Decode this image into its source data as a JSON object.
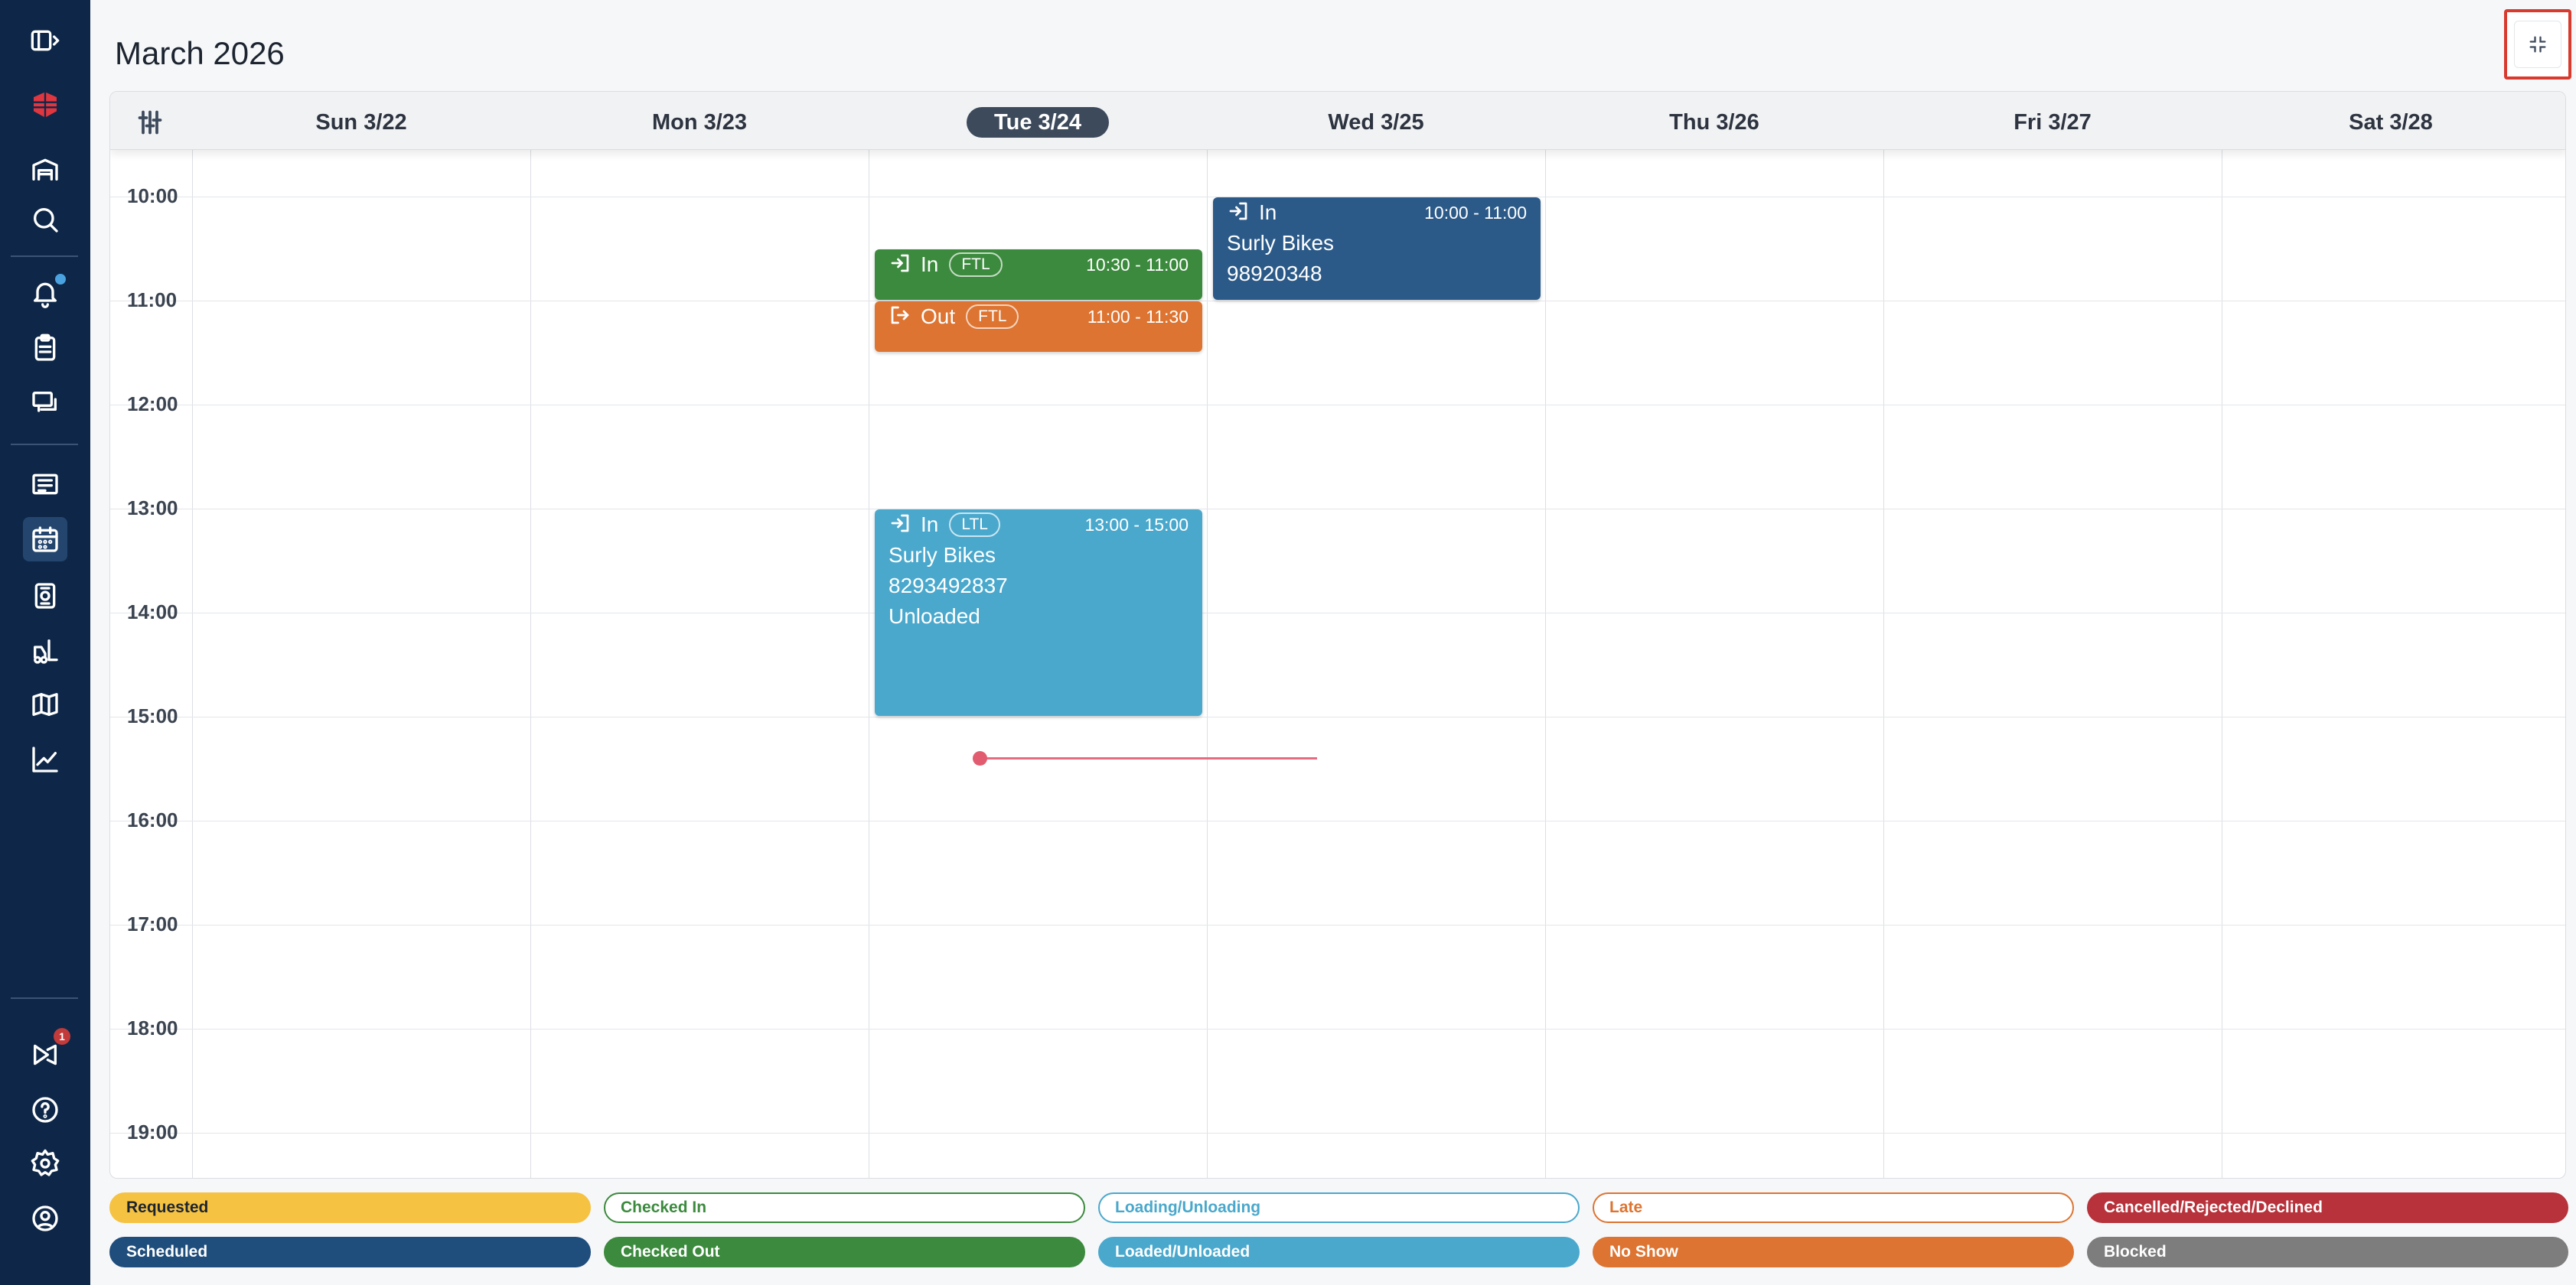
{
  "title": "March 2026",
  "sidebar": {
    "icons": [
      "sidebar-toggle-icon",
      "logo-icon",
      "warehouse-icon",
      "search-icon",
      "notifications-icon",
      "clipboard-icon",
      "chat-icon",
      "list-icon",
      "calendar-icon",
      "dock-icon",
      "forklift-icon",
      "map-icon",
      "analytics-icon",
      "announcements-icon",
      "help-icon",
      "settings-icon",
      "profile-icon"
    ],
    "announcement_badge": "1"
  },
  "header": {
    "collapse_icon": "collapse-icon",
    "filter_icon": "filter-sliders-icon"
  },
  "days": [
    {
      "label": "Sun 3/22",
      "today": false
    },
    {
      "label": "Mon 3/23",
      "today": false
    },
    {
      "label": "Tue 3/24",
      "today": true
    },
    {
      "label": "Wed 3/25",
      "today": false
    },
    {
      "label": "Thu 3/26",
      "today": false
    },
    {
      "label": "Fri 3/27",
      "today": false
    },
    {
      "label": "Sat 3/28",
      "today": false
    }
  ],
  "hours": [
    "10:00",
    "11:00",
    "12:00",
    "13:00",
    "14:00",
    "15:00",
    "16:00",
    "17:00",
    "18:00",
    "19:00"
  ],
  "events": [
    {
      "day": "Wed 3/25",
      "direction": "In",
      "type": "",
      "time": "10:00 - 11:00",
      "lines": [
        "Surly Bikes",
        "98920348"
      ],
      "color": "#2c5a88",
      "status": "Scheduled"
    },
    {
      "day": "Tue 3/24",
      "direction": "In",
      "type": "FTL",
      "time": "10:30 - 11:00",
      "lines": [],
      "color": "#3c8a3e",
      "status": "Checked Out"
    },
    {
      "day": "Tue 3/24",
      "direction": "Out",
      "type": "FTL",
      "time": "11:00 - 11:30",
      "lines": [],
      "color": "#dd7431",
      "status": "No Show"
    },
    {
      "day": "Tue 3/24",
      "direction": "In",
      "type": "LTL",
      "time": "13:00 - 15:00",
      "lines": [
        "Surly Bikes",
        "8293492837",
        "Unloaded"
      ],
      "color": "#4aa8cc",
      "status": "Loaded/Unloaded"
    }
  ],
  "legend": [
    {
      "label": "Requested",
      "bg": "#f5c242",
      "fg": "#1c2430",
      "border": "#f5c242"
    },
    {
      "label": "Checked In",
      "bg": "#ffffff",
      "fg": "#3c8a3e",
      "border": "#3c8a3e"
    },
    {
      "label": "Loading/Unloading",
      "bg": "#ffffff",
      "fg": "#4aa8cc",
      "border": "#4aa8cc"
    },
    {
      "label": "Late",
      "bg": "#ffffff",
      "fg": "#dd7431",
      "border": "#dd7431"
    },
    {
      "label": "Cancelled/Rejected/Declined",
      "bg": "#b7323b",
      "fg": "#ffffff",
      "border": "#b7323b"
    },
    {
      "label": "Scheduled",
      "bg": "#1f4d7c",
      "fg": "#ffffff",
      "border": "#1f4d7c"
    },
    {
      "label": "Checked Out",
      "bg": "#3c8a3e",
      "fg": "#ffffff",
      "border": "#3c8a3e"
    },
    {
      "label": "Loaded/Unloaded",
      "bg": "#4aa8cc",
      "fg": "#ffffff",
      "border": "#4aa8cc"
    },
    {
      "label": "No Show",
      "bg": "#dd7431",
      "fg": "#ffffff",
      "border": "#dd7431"
    },
    {
      "label": "Blocked",
      "bg": "#7d7d7d",
      "fg": "#ffffff",
      "border": "#7d7d7d"
    }
  ]
}
